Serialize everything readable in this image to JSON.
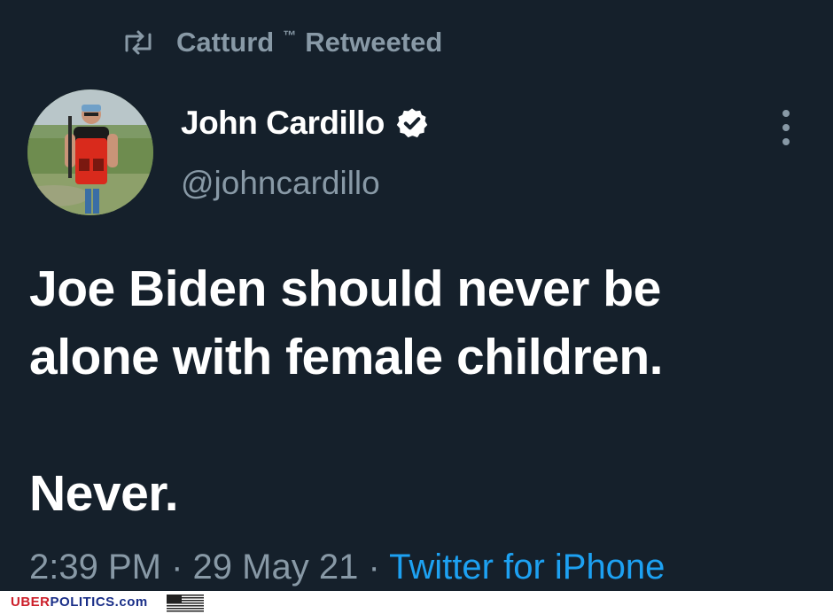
{
  "retweet": {
    "icon": "retweet-icon",
    "by": "Catturd",
    "tm": "™",
    "label": "Retweeted"
  },
  "author": {
    "name": "John Cardillo",
    "handle": "@johncardillo",
    "verified_icon": "verified-badge-icon"
  },
  "tweet": {
    "text": "Joe Biden should never be\nalone with female children.\n\nNever."
  },
  "meta": {
    "time": "2:39 PM",
    "separator": "·",
    "date": "29 May 21",
    "source": "Twitter for iPhone"
  },
  "watermark": {
    "uber": "UBER",
    "politics": "POLITICS.com"
  },
  "colors": {
    "background": "#15202b",
    "text_primary": "#ffffff",
    "text_secondary": "#8899a6",
    "link": "#1da1f2"
  }
}
